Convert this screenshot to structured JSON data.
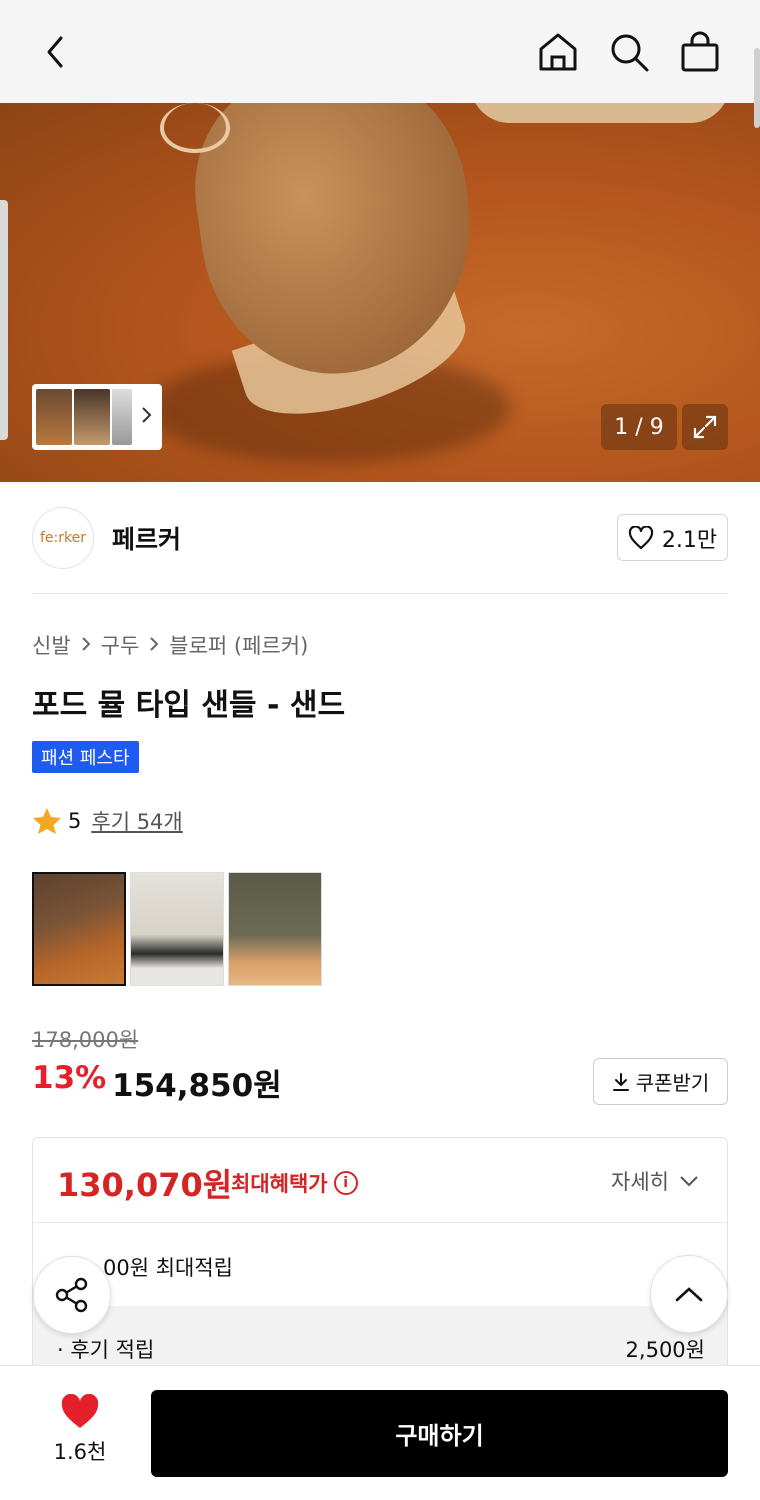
{
  "header": {
    "back_icon": "chevron-left-icon",
    "home_icon": "home-icon",
    "search_icon": "search-icon",
    "cart_icon": "shopping-bag-icon"
  },
  "gallery": {
    "counter": "1 / 9"
  },
  "brand": {
    "logo_text": "fe:rker",
    "name": "페르커",
    "likes": "2.1만"
  },
  "breadcrumb": [
    "신발",
    "구두",
    "블로퍼 (페르커)"
  ],
  "product": {
    "title": "포드 뮬 타입 샌들 - 샌드",
    "promo_badge": "패션 페스타",
    "rating": "5",
    "reviews": "후기 54개",
    "original_price": "178,000원",
    "discount": "13%",
    "price": "154,850원",
    "coupon_label": "쿠폰받기"
  },
  "benefit": {
    "max_price": "130,070원",
    "max_label": "최대혜택가",
    "details_label": "자세히",
    "points_text": "00원 최대적립",
    "review_points_label": "· 후기 적립",
    "review_points_value": "2,500원"
  },
  "bottom": {
    "wish_count": "1.6천",
    "buy_label": "구매하기"
  },
  "colors": {
    "accent_red": "#e5202a",
    "badge_blue": "#1f5bf0"
  }
}
